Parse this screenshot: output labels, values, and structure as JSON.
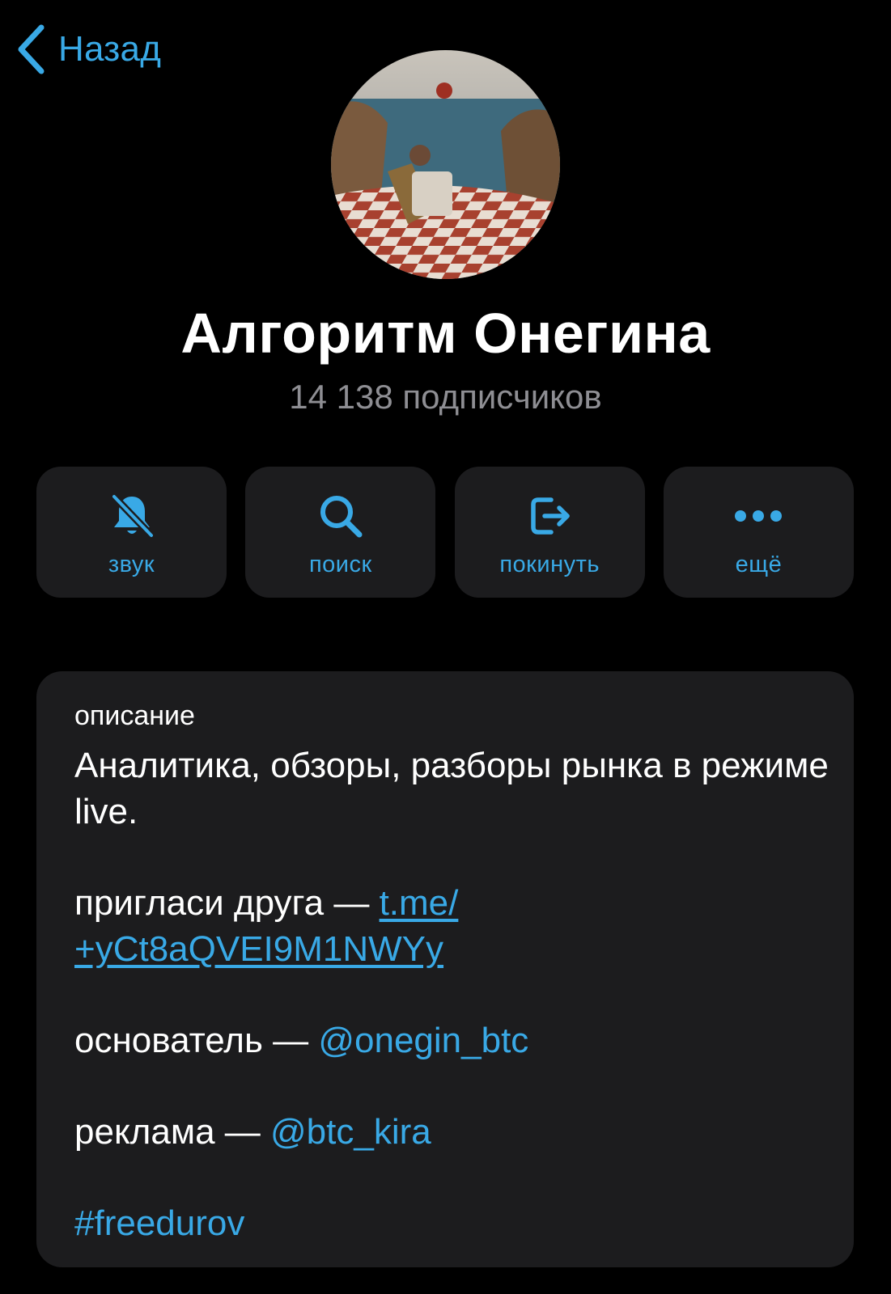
{
  "nav": {
    "back_label": "Назад"
  },
  "channel": {
    "title": "Алгоритм Онегина",
    "subscribers": "14 138 подписчиков"
  },
  "actions": [
    {
      "label": "звук",
      "icon": "bell-slash-icon"
    },
    {
      "label": "поиск",
      "icon": "search-icon"
    },
    {
      "label": "покинуть",
      "icon": "leave-icon"
    },
    {
      "label": "ещё",
      "icon": "more-icon"
    }
  ],
  "description": {
    "heading": "описание",
    "text": "Аналитика, обзоры, разборы рынка в режиме live.",
    "invite_prefix": "пригласи друга — ",
    "invite_link_1": "t.me/",
    "invite_link_2": "+yCt8aQVEI9M1NWYy",
    "founder_prefix": "основатель — ",
    "founder_handle": "@onegin_btc",
    "ads_prefix": "реклама — ",
    "ads_handle": "@btc_kira",
    "hashtag": "#freedurov"
  },
  "colors": {
    "background": "#000000",
    "card": "#1c1c1e",
    "accent": "#39a9e6",
    "secondary_text": "#8e8e93"
  }
}
